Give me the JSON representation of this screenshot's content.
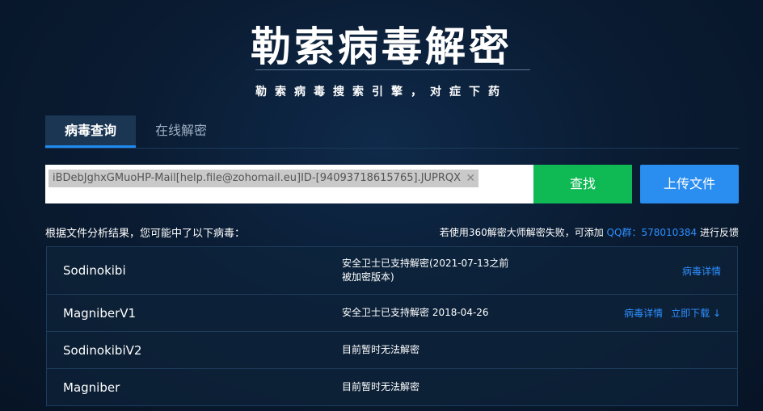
{
  "header": {
    "title": "勒索病毒解密",
    "subtitle": "勒索病毒搜索引擎，对症下药"
  },
  "tabs": [
    {
      "label": "病毒查询",
      "active": true
    },
    {
      "label": "在线解密",
      "active": false
    }
  ],
  "search": {
    "value": "iBDebJghxGMuoHP-Mail[help.file@zohomail.eu]ID-[94093718615765].JUPRQX",
    "search_button": "查找",
    "upload_button": "上传文件"
  },
  "result": {
    "summary": "根据文件分析结果，您可能中了以下病毒：",
    "feedback_prefix": "若使用360解密大师解密失败，可添加",
    "qq_link": "QQ群：578010384",
    "feedback_suffix": "进行反馈"
  },
  "rows": [
    {
      "name": "Sodinokibi",
      "status": "安全卫士已支持解密(2021-07-13之前被加密版本)",
      "links": [
        "病毒详情"
      ]
    },
    {
      "name": "MagniberV1",
      "status": "安全卫士已支持解密 2018-04-26",
      "links": [
        "病毒详情",
        "立即下载 ↓"
      ]
    },
    {
      "name": "SodinokibiV2",
      "status": "目前暂时无法解密",
      "links": []
    },
    {
      "name": "Magniber",
      "status": "目前暂时无法解密",
      "links": []
    }
  ],
  "colors": {
    "accent_blue": "#2a8ef0",
    "search_green": "#0fba55",
    "link_blue": "#2e8fff"
  }
}
